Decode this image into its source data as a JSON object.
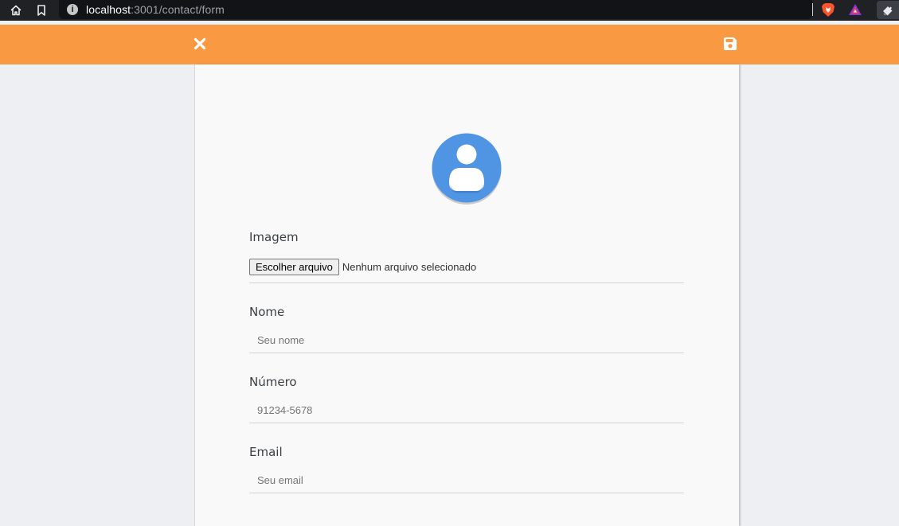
{
  "browser": {
    "url_host": "localhost",
    "url_path": ":3001/contact/form",
    "info_icon": "i"
  },
  "header": {
    "background": "#f99a43",
    "close_icon": "close-icon",
    "save_icon": "floppy-disk-icon"
  },
  "form": {
    "avatar_icon": "user-avatar-icon",
    "avatar_color": "#5094e4",
    "fields": {
      "image": {
        "label": "Imagem",
        "button_label": "Escolher arquivo",
        "status": "Nenhum arquivo selecionado"
      },
      "name": {
        "label": "Nome",
        "placeholder": "Seu nome"
      },
      "number": {
        "label": "Número",
        "placeholder": "91234-5678"
      },
      "email": {
        "label": "Email",
        "placeholder": "Seu email"
      }
    }
  }
}
